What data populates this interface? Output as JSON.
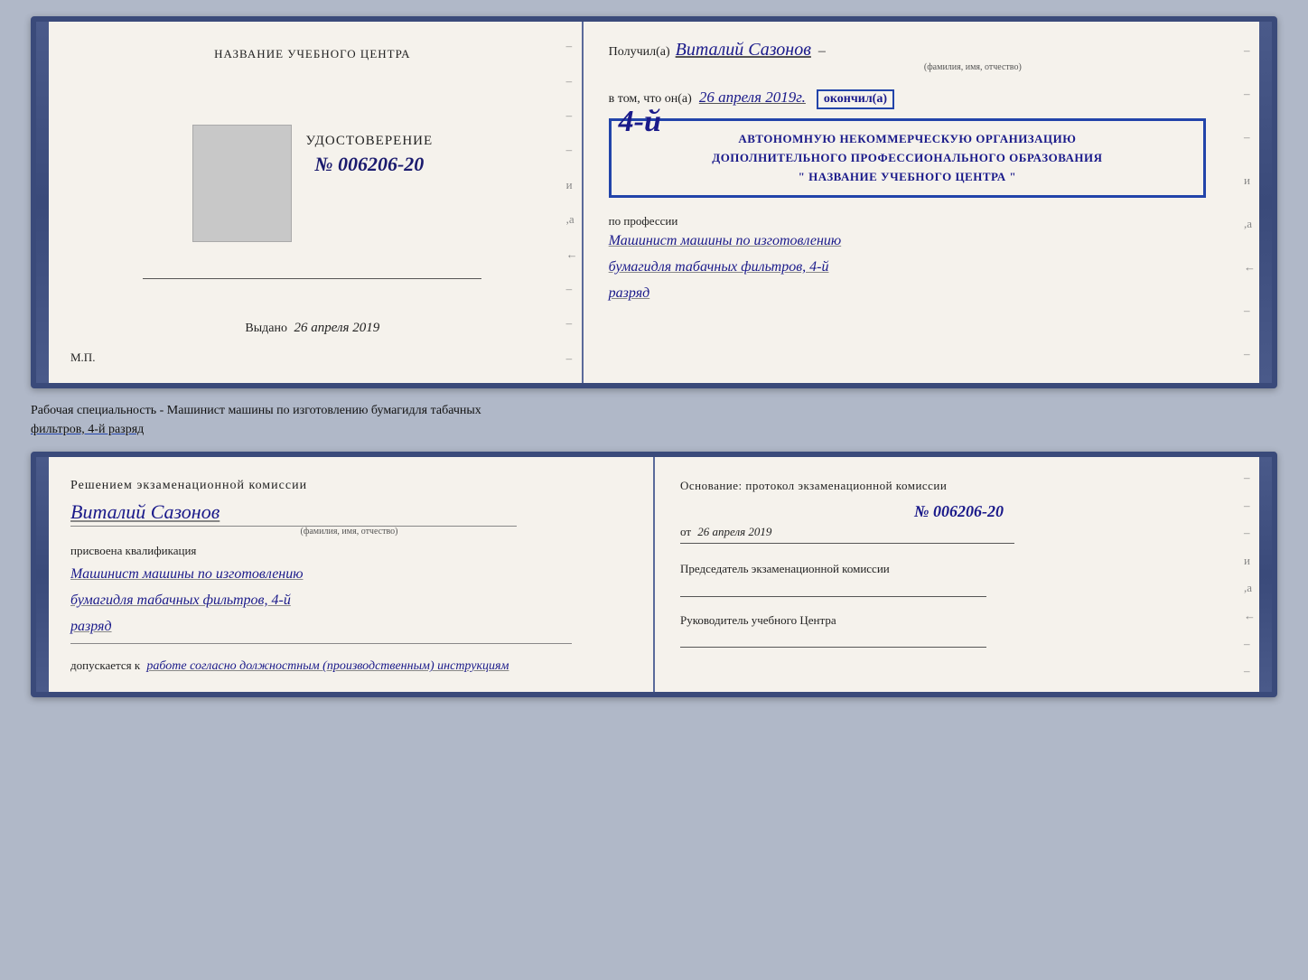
{
  "top_book": {
    "left_page": {
      "title": "НАЗВАНИЕ УЧЕБНОГО ЦЕНТРА",
      "udostoverenie_label": "УДОСТОВЕРЕНИЕ",
      "number": "№ 006206-20",
      "vydano_prefix": "Выдано",
      "vydano_date": "26 апреля 2019",
      "mp": "М.П."
    },
    "right_page": {
      "poluchil_prefix": "Получил(а)",
      "recipient_name": "Виталий Сазонов",
      "fio_caption": "(фамилия, имя, отчество)",
      "vtom_prefix": "в том, что он(а)",
      "vtom_date": "26 апреля 2019г.",
      "okonchil": "окончил(а)",
      "stamp_number": "4-й",
      "stamp_line1": "АВТОНОМНУЮ НЕКОММЕРЧЕСКУЮ ОРГАНИЗАЦИЮ",
      "stamp_line2": "ДОПОЛНИТЕЛЬНОГО ПРОФЕССИОНАЛЬНОГО ОБРАЗОВАНИЯ",
      "stamp_line3": "\" НАЗВАНИЕ УЧЕБНОГО ЦЕНТРА \"",
      "po_professii": "по профессии",
      "profession_line1": "Машинист машины по изготовлению",
      "profession_line2": "бумагидля табачных фильтров, 4-й",
      "profession_line3": "разряд"
    }
  },
  "separator": {
    "text": "Рабочая специальность - Машинист машины по изготовлению бумагидля табачных",
    "underline_text": "фильтров, 4-й разряд"
  },
  "bottom_book": {
    "left_page": {
      "decision_title": "Решением  экзаменационной  комиссии",
      "name": "Виталий Сазонов",
      "fio_caption": "(фамилия, имя, отчество)",
      "prisvoena_label": "присвоена квалификация",
      "qual_line1": "Машинист машины по изготовлению",
      "qual_line2": "бумагидля табачных фильтров, 4-й",
      "qual_line3": "разряд",
      "dopuskaetsya_prefix": "допускается к",
      "dopuskaetsya_text": "работе согласно должностным (производственным) инструкциям"
    },
    "right_page": {
      "osnovaniye": "Основание:  протокол  экзаменационной  комиссии",
      "number": "№  006206-20",
      "ot_prefix": "от",
      "ot_date": "26 апреля 2019",
      "predsedatel_label": "Председатель экзаменационной комиссии",
      "rukovoditel_label": "Руководитель учебного Центра"
    }
  }
}
